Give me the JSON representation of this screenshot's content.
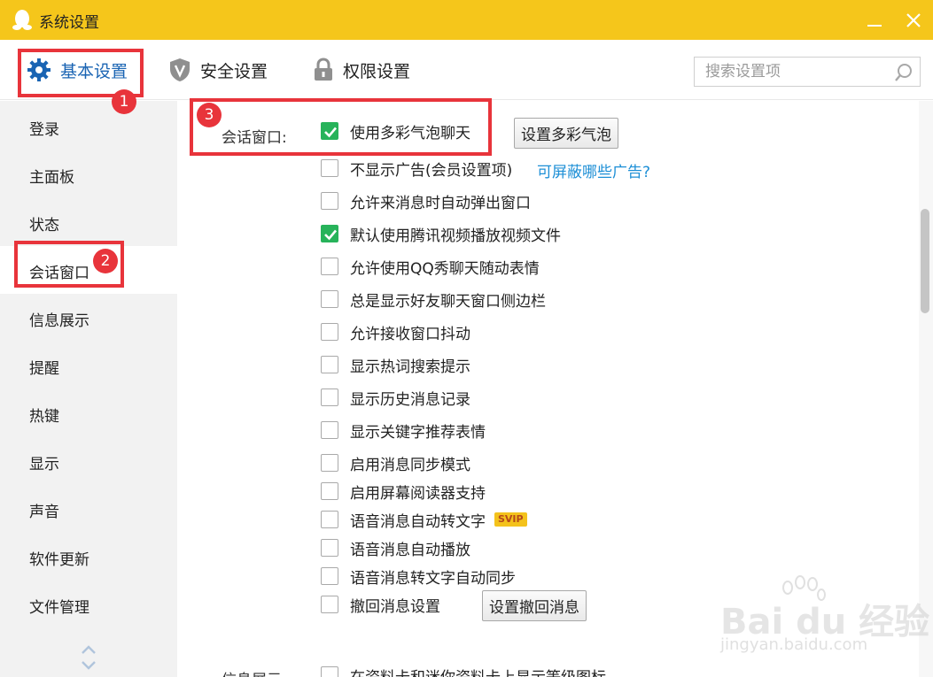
{
  "window": {
    "title": "系统设置"
  },
  "tabs": [
    {
      "label": "基本设置",
      "active": true
    },
    {
      "label": "安全设置"
    },
    {
      "label": "权限设置"
    }
  ],
  "search": {
    "placeholder": "搜索设置项",
    "value": ""
  },
  "sidebar": {
    "items": [
      {
        "label": "登录"
      },
      {
        "label": "主面板"
      },
      {
        "label": "状态"
      },
      {
        "label": "会话窗口",
        "active": true
      },
      {
        "label": "信息展示"
      },
      {
        "label": "提醒"
      },
      {
        "label": "热键"
      },
      {
        "label": "显示"
      },
      {
        "label": "声音"
      },
      {
        "label": "软件更新"
      },
      {
        "label": "文件管理"
      }
    ]
  },
  "session_window": {
    "group_label": "会话窗口:",
    "options": [
      {
        "label": "使用多彩气泡聊天",
        "checked": true
      },
      {
        "label": "不显示广告(会员设置项)",
        "checked": false
      },
      {
        "label": "允许来消息时自动弹出窗口",
        "checked": false
      },
      {
        "label": "默认使用腾讯视频播放视频文件",
        "checked": true
      },
      {
        "label": "允许使用QQ秀聊天随动表情",
        "checked": false
      },
      {
        "label": "总是显示好友聊天窗口侧边栏",
        "checked": false
      },
      {
        "label": "允许接收窗口抖动",
        "checked": false
      },
      {
        "label": "显示热词搜索提示",
        "checked": false
      },
      {
        "label": "显示历史消息记录",
        "checked": false
      },
      {
        "label": "显示关键字推荐表情",
        "checked": false
      },
      {
        "label": "启用消息同步模式",
        "checked": false
      },
      {
        "label": "启用屏幕阅读器支持",
        "checked": false
      },
      {
        "label": "语音消息自动转文字",
        "checked": false
      },
      {
        "label": "语音消息自动播放",
        "checked": false
      },
      {
        "label": "语音消息转文字自动同步",
        "checked": false
      },
      {
        "label": "撤回消息设置",
        "checked": false
      }
    ],
    "bubble_button": "设置多彩气泡",
    "ads_link": "可屏蔽哪些广告?",
    "svip_badge": "SVIP",
    "recall_button": "设置撤回消息"
  },
  "info_display": {
    "group_label": "信息展示:",
    "options": [
      {
        "label": "在资料卡和迷你资料卡上显示等级图标",
        "checked": false
      }
    ]
  },
  "annotations": [
    "1",
    "2",
    "3"
  ],
  "watermark": {
    "main": "Bai du 经验",
    "sub": "jingyan.baidu.com"
  },
  "colors": {
    "titlebar": "#f5c61b",
    "active_tab": "#1a64b3",
    "checkbox_checked": "#27b35a",
    "link": "#1d8fd6",
    "annotation": "#e8343b",
    "svip_badge": "#f4c21c"
  }
}
